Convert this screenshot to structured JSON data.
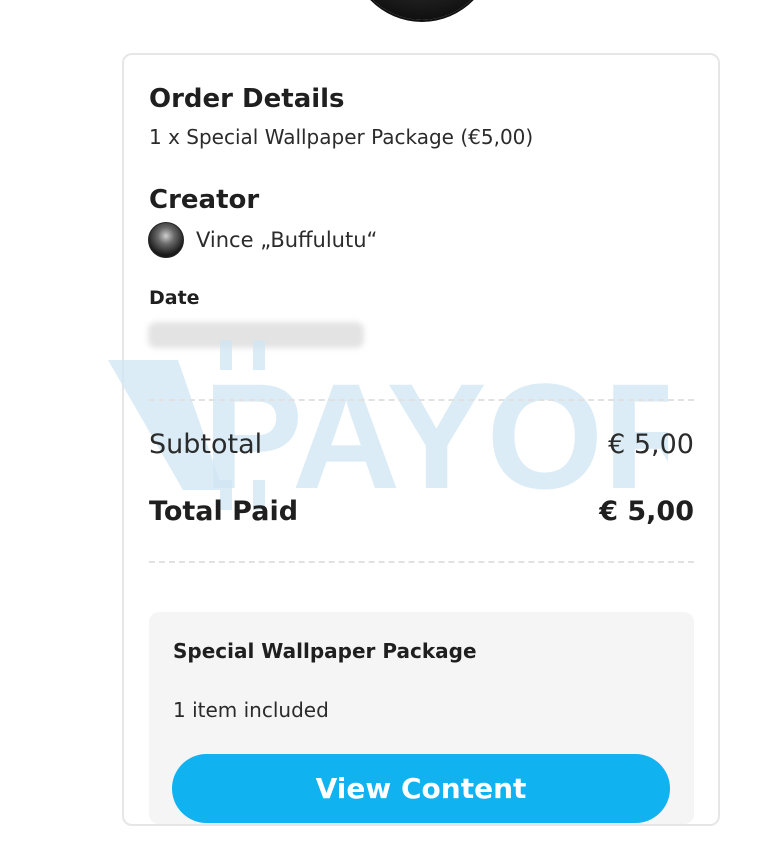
{
  "order": {
    "title": "Order Details",
    "line": "1 x Special Wallpaper Package (€5,00)"
  },
  "creator": {
    "title": "Creator",
    "name": "Vince „Buffulutu“"
  },
  "date": {
    "label": "Date"
  },
  "summary": {
    "subtotal_label": "Subtotal",
    "subtotal_value": "€ 5,00",
    "total_label": "Total Paid",
    "total_value": "€ 5,00"
  },
  "package": {
    "title": "Special Wallpaper Package",
    "count": "1 item included",
    "button_label": "View Content"
  },
  "watermark": {
    "text": "PAYOR",
    "color": "#cfe6f3"
  },
  "colors": {
    "accent": "#10b2ef",
    "card_border": "#e6e6e6",
    "package_bg": "#f5f5f5"
  }
}
